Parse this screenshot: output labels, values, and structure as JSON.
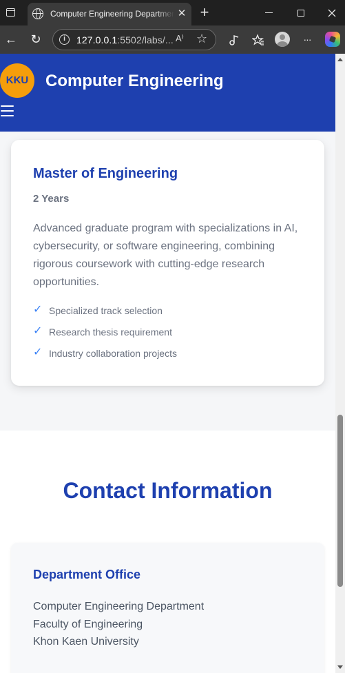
{
  "browser": {
    "tab_title": "Computer Engineering Department",
    "tab_close": "✕",
    "new_tab": "+",
    "url_host": "127.0.0.1",
    "url_rest": ":5502/labs/...",
    "read_aloud": "A⁾",
    "back": "←",
    "reload": "↻",
    "more": "···"
  },
  "header": {
    "logo_text": "KKU",
    "site_title": "Computer Engineering"
  },
  "program": {
    "title": "Master of Engineering",
    "duration": "2 Years",
    "description": "Advanced graduate program with specializations in AI, cybersecurity, or software engineering, combining rigorous coursework with cutting-edge research opportunities.",
    "check_glyph": "✓",
    "features": [
      "Specialized track selection",
      "Research thesis requirement",
      "Industry collaboration projects"
    ]
  },
  "contact": {
    "heading": "Contact Information",
    "office_title": "Department Office",
    "office_lines": [
      "Computer Engineering Department",
      "Faculty of Engineering",
      "Khon Kaen University"
    ]
  },
  "colors": {
    "brand_blue": "#1e40af",
    "logo_orange": "#f59e0b",
    "check_blue": "#3b82f6"
  },
  "icons": [
    "tab-actions-icon",
    "globe-icon",
    "close-icon",
    "plus-icon",
    "back-arrow-icon",
    "reload-icon",
    "info-icon",
    "read-aloud-icon",
    "favorite-star-icon",
    "extensions-icon",
    "favorites-icon",
    "profile-avatar-icon",
    "more-icon",
    "copilot-icon",
    "hamburger-menu-icon",
    "checkmark-icon"
  ]
}
